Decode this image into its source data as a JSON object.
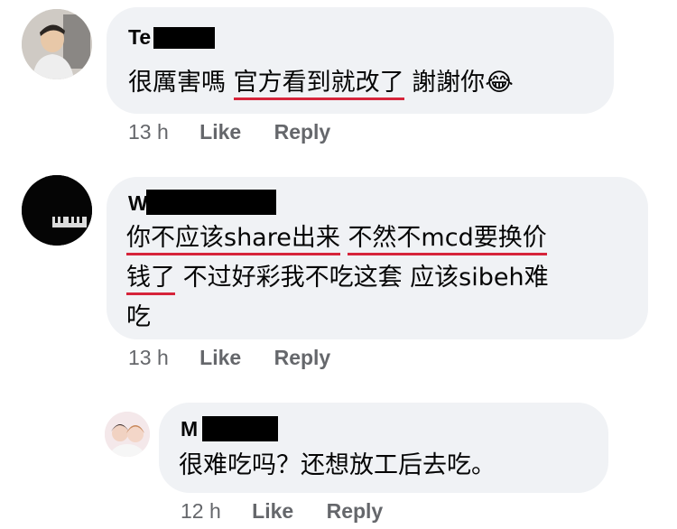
{
  "comments": [
    {
      "author": "Te",
      "time": "13 h",
      "like": "Like",
      "reply": "Reply",
      "text": {
        "p1": "很厲害嗎 ",
        "p2": "官方看到就改了",
        "p3": " 謝謝你",
        "emoji": "😂"
      }
    },
    {
      "author": "W",
      "time": "13 h",
      "like": "Like",
      "reply": "Reply",
      "text": {
        "l1a": "你不应该share出来",
        "l1b": " ",
        "l1c": "不然不mcd要换价",
        "l2a": "钱了",
        "l2b": " 不过好彩我不吃这套 应该sibeh难",
        "l3": "吃"
      }
    },
    {
      "author": "M",
      "time": "12 h",
      "like": "Like",
      "reply": "Reply",
      "text": "很难吃吗？还想放工后去吃。"
    }
  ]
}
